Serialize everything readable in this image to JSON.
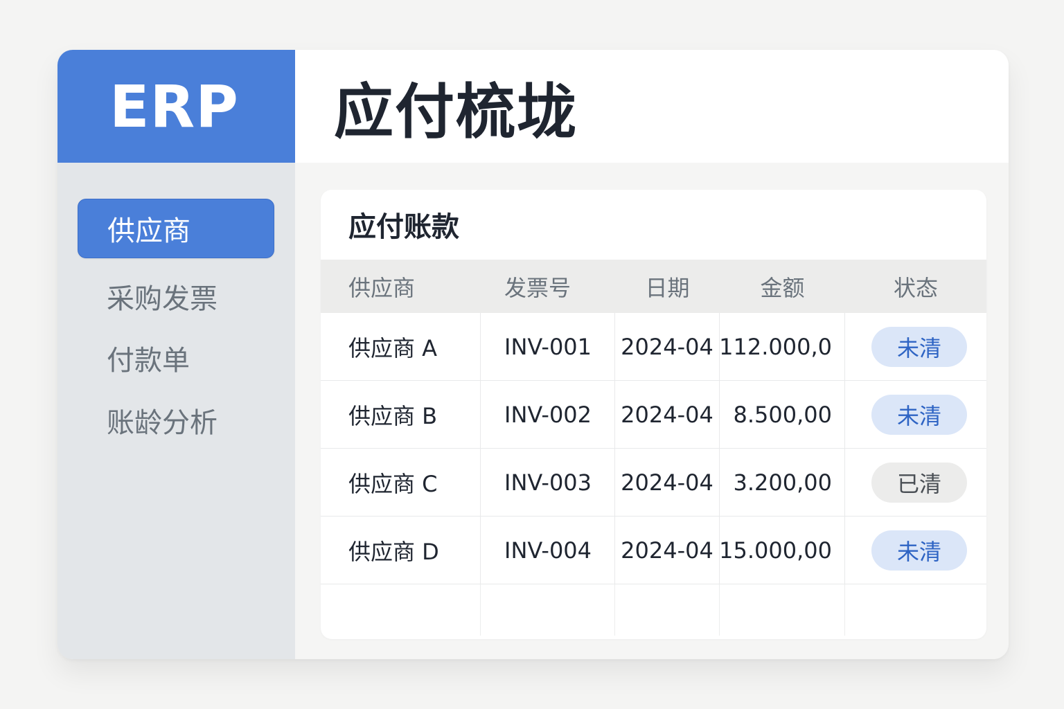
{
  "app": {
    "brand": "ERP"
  },
  "sidebar": {
    "items": [
      {
        "label": "供应商",
        "active": true
      },
      {
        "label": "采购发票",
        "active": false
      },
      {
        "label": "付款单",
        "active": false
      },
      {
        "label": "账龄分析",
        "active": false
      }
    ]
  },
  "header": {
    "title": "应付梳垅"
  },
  "card": {
    "title": "应付账款"
  },
  "table": {
    "columns": [
      "供应商",
      "发票号",
      "日期",
      "金额",
      "状态"
    ],
    "rows": [
      {
        "supplier": "供应商 A",
        "invoice": "INV-001",
        "date": "2024-04",
        "amount": "112.000,0",
        "status": "未清",
        "status_type": "open"
      },
      {
        "supplier": "供应商 B",
        "invoice": "INV-002",
        "date": "2024-04",
        "amount": "8.500,00",
        "status": "未清",
        "status_type": "open"
      },
      {
        "supplier": "供应商 C",
        "invoice": "INV-003",
        "date": "2024-04",
        "amount": "3.200,00",
        "status": "已清",
        "status_type": "paid"
      },
      {
        "supplier": "供应商 D",
        "invoice": "INV-004",
        "date": "2024-04",
        "amount": "15.000,00",
        "status": "未清",
        "status_type": "open"
      }
    ]
  },
  "colors": {
    "accent": "#4a7fd9",
    "sidebar_bg": "#e3e6e9",
    "badge_open_bg": "#dbe6f8",
    "badge_open_text": "#2e64c4",
    "badge_paid_bg": "#ececeb"
  }
}
